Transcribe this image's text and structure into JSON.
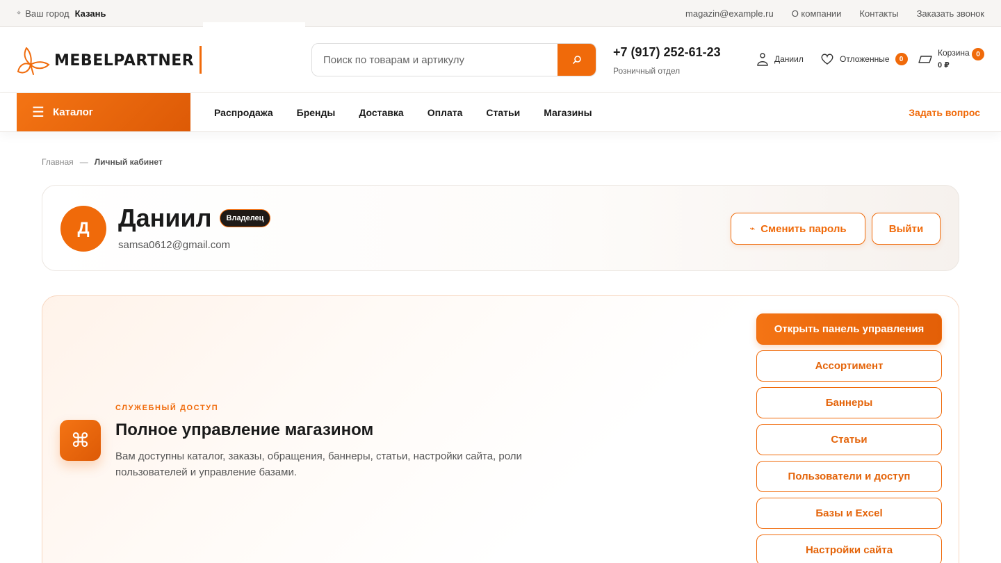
{
  "topbar": {
    "city_label": "Ваш город",
    "city": "Казань",
    "links": [
      "magazin@example.ru",
      "О компании",
      "Контакты",
      "Заказать звонок"
    ]
  },
  "header": {
    "logo_text": "MEBELPARTNER",
    "search_placeholder": "Поиск по товарам и артикулу",
    "phone": "+7 (917) 252-61-23",
    "phone_sub": "Розничный отдел",
    "user_name": "Даниил",
    "favorites_label": "Отложенные",
    "favorites_count": "0",
    "cart_label": "Корзина",
    "cart_total": "0 ₽",
    "cart_count": "0"
  },
  "nav": {
    "catalog": "Каталог",
    "links": [
      "Распродажа",
      "Бренды",
      "Доставка",
      "Оплата",
      "Статьи",
      "Магазины"
    ],
    "ask": "Задать вопрос"
  },
  "breadcrumb": {
    "home": "Главная",
    "sep": "—",
    "current": "Личный кабинет"
  },
  "profile": {
    "initial": "Д",
    "name": "Даниил",
    "role": "Владелец",
    "email": "samsa0612@gmail.com",
    "change_password": "Сменить пароль",
    "logout": "Выйти"
  },
  "admin": {
    "kicker": "СЛУЖЕБНЫЙ ДОСТУП",
    "title": "Полное управление магазином",
    "description": "Вам доступны каталог, заказы, обращения, баннеры, статьи, настройки сайта, роли пользователей и управление базами.",
    "open_panel": "Открыть панель управления",
    "buttons": [
      "Ассортимент",
      "Баннеры",
      "Статьи",
      "Пользователи и доступ",
      "Базы и Excel",
      "Настройки сайта"
    ]
  },
  "colors": {
    "accent": "#f06a0a",
    "dark": "#1a1a1a",
    "badge_dark": "#1f1a17"
  }
}
